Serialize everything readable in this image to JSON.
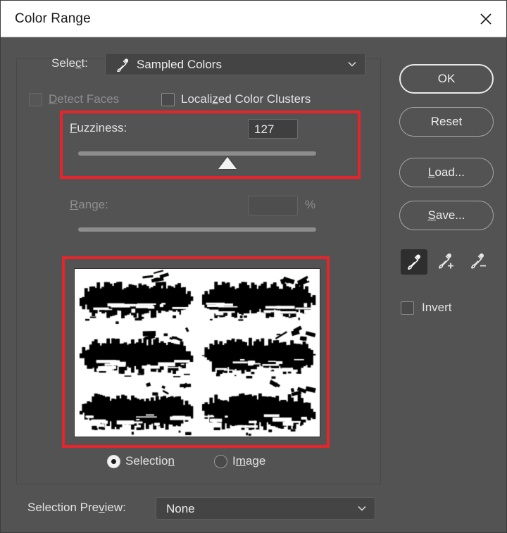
{
  "window": {
    "title": "Color Range",
    "close_icon": "close-icon"
  },
  "select_row": {
    "label": "Select:",
    "value": "Sampled Colors",
    "icon": "eyedropper-icon",
    "chevron": "chevron-down-icon"
  },
  "checkboxes": {
    "detect_faces": {
      "label": "Detect Faces",
      "checked": false,
      "enabled": false
    },
    "localized_color_clusters": {
      "label": "Localized Color Clusters",
      "checked": false,
      "enabled": true
    },
    "invert": {
      "label": "Invert",
      "checked": false,
      "enabled": true
    }
  },
  "fuzziness": {
    "label": "Fuzziness:",
    "value": "127",
    "slider_percent": 62,
    "min": 0,
    "max": 200
  },
  "range": {
    "label": "Range:",
    "value": "",
    "unit": "%",
    "enabled": false
  },
  "preview": {
    "name": "selection-preview-thumbnail",
    "description": "Black brush strokes on white selection mask, 2 columns by 3 rows"
  },
  "preview_mode": {
    "selection": {
      "label": "Selection",
      "checked": true
    },
    "image": {
      "label": "Image",
      "checked": false
    }
  },
  "selection_preview": {
    "label": "Selection Preview:",
    "value": "None",
    "chevron": "chevron-down-icon"
  },
  "buttons": {
    "ok": "OK",
    "reset": "Reset",
    "load": "Load...",
    "save": "Save..."
  },
  "tools": {
    "sample": {
      "name": "eyedropper-icon",
      "active": true
    },
    "sample_add": {
      "name": "eyedropper-plus-icon",
      "active": false
    },
    "sample_subtract": {
      "name": "eyedropper-minus-icon",
      "active": false
    }
  },
  "annotations": {
    "fuzziness_highlight_color": "#e8232a",
    "preview_highlight_color": "#e8232a"
  },
  "colors": {
    "dialog_background": "#535353",
    "titlebar_background": "#ffffff",
    "text": "#e2e2e2",
    "disabled_text": "#8e8e8e",
    "field_background": "#444444",
    "annotation_red": "#e8232a"
  }
}
